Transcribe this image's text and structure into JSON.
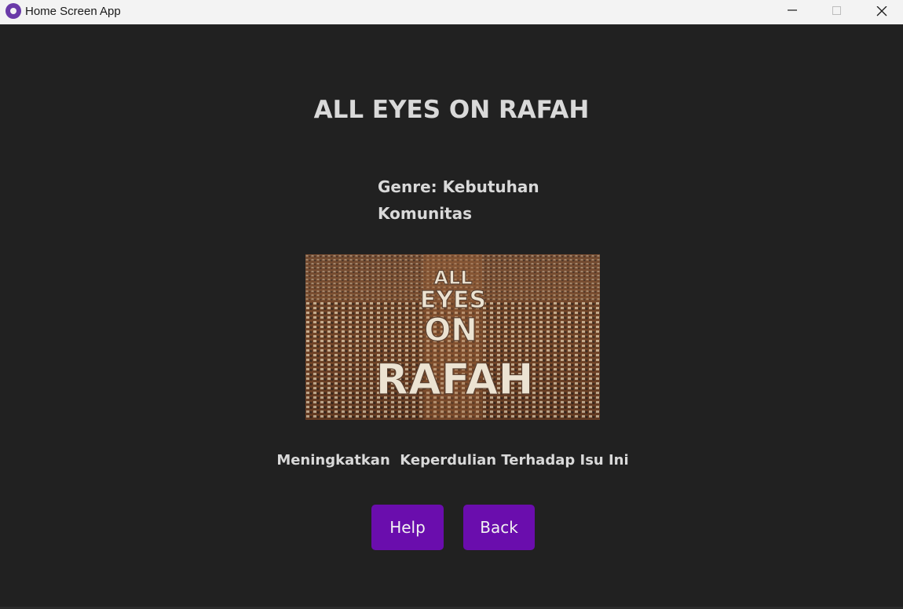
{
  "window": {
    "title": "Home Screen App",
    "controls": [
      "minimize-icon",
      "maximize-icon",
      "close-icon"
    ]
  },
  "main": {
    "title": "ALL EYES ON RAFAH",
    "genre_line1": "Genre: Kebutuhan",
    "genre_line2": "Komunitas",
    "image": {
      "description_icon": "poster-image",
      "text_lines": [
        "ALL",
        "EYES",
        "ON",
        "RAFAH"
      ]
    },
    "subtitle": "Meningkatkan  Keperdulian Terhadap Isu Ini",
    "buttons": {
      "help_label": "Help",
      "back_label": "Back"
    }
  },
  "colors": {
    "background": "#212121",
    "titlebar": "#f3f3f3",
    "text": "#d9d9d9",
    "button": "#6a0dad",
    "button_text": "#f2f2f2",
    "app_icon": "#6a3aa8"
  }
}
